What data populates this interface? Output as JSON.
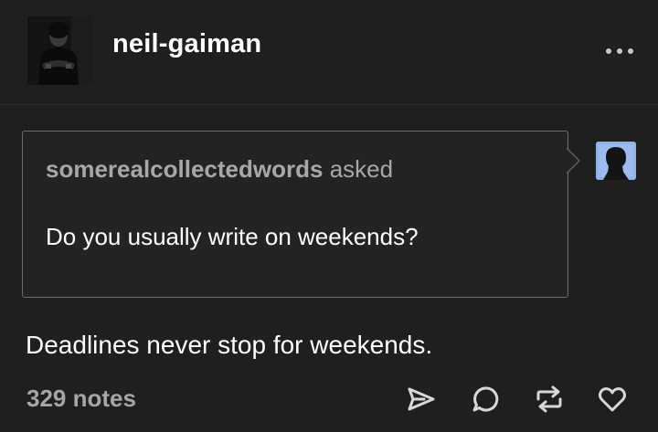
{
  "post": {
    "blog_name": "neil-gaiman",
    "asker": "somerealcollectedwords",
    "asked_label": "asked",
    "question": "Do you usually write on weekends?",
    "answer": "Deadlines never stop for weekends.",
    "notes": "329 notes"
  },
  "icons": {
    "more": "more-horizontal-icon",
    "share": "share-send-icon",
    "reply": "reply-comment-icon",
    "reblog": "reblog-icon",
    "like": "heart-icon"
  },
  "colors": {
    "background": "#1f1f1f",
    "box_border": "#6d6d6d",
    "muted_text": "#a8a8a8",
    "asker_avatar": "#8fb2e8"
  }
}
